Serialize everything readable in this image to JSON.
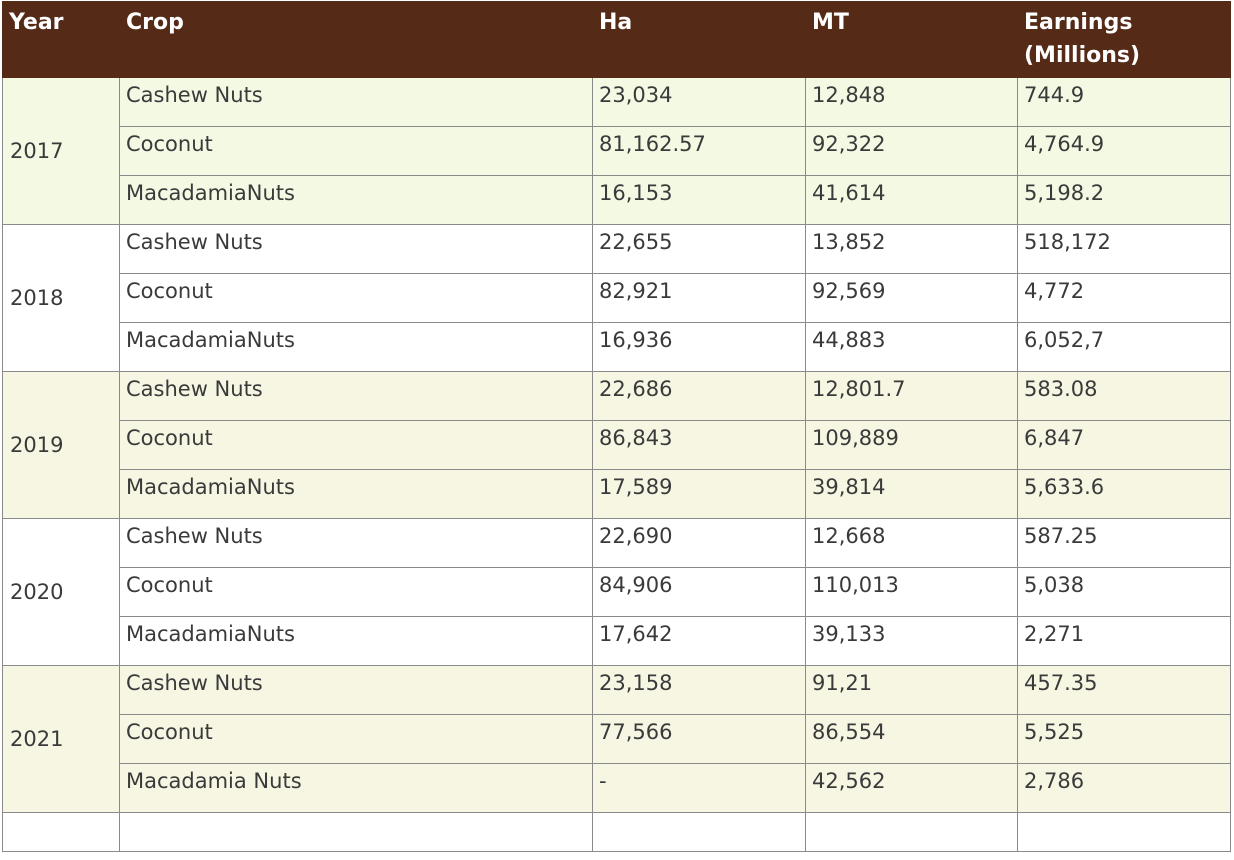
{
  "headers": {
    "year": "Year",
    "crop": "Crop",
    "ha": "Ha",
    "mt": "MT",
    "earnings_line1": "Earnings",
    "earnings_line2": "(Millions)"
  },
  "years": [
    {
      "year": "2017",
      "rows": [
        {
          "crop": "Cashew Nuts",
          "ha": "23,034",
          "mt": "12,848",
          "earnings": "744.9"
        },
        {
          "crop": "Coconut",
          "ha": "81,162.57",
          "mt": "92,322",
          "earnings": "4,764.9"
        },
        {
          "crop": "MacadamiaNuts",
          "ha": "16,153",
          "mt": "41,614",
          "earnings": "5,198.2"
        }
      ]
    },
    {
      "year": "2018",
      "rows": [
        {
          "crop": "Cashew Nuts",
          "ha": "22,655",
          "mt": "13,852",
          "earnings": "518,172"
        },
        {
          "crop": "Coconut",
          "ha": "82,921",
          "mt": "92,569",
          "earnings": "4,772"
        },
        {
          "crop": "MacadamiaNuts",
          "ha": "16,936",
          "mt": "44,883",
          "earnings": "6,052,7"
        }
      ]
    },
    {
      "year": "2019",
      "rows": [
        {
          "crop": "Cashew Nuts",
          "ha": "22,686",
          "mt": "12,801.7",
          "earnings": "583.08"
        },
        {
          "crop": "Coconut",
          "ha": "86,843",
          "mt": "109,889",
          "earnings": "6,847"
        },
        {
          "crop": "MacadamiaNuts",
          "ha": "17,589",
          "mt": "39,814",
          "earnings": "5,633.6"
        }
      ]
    },
    {
      "year": "2020",
      "rows": [
        {
          "crop": "Cashew Nuts",
          "ha": "22,690",
          "mt": "12,668",
          "earnings": "587.25"
        },
        {
          "crop": "Coconut",
          "ha": "84,906",
          "mt": "110,013",
          "earnings": "5,038"
        },
        {
          "crop": "MacadamiaNuts",
          "ha": "17,642",
          "mt": "39,133",
          "earnings": "2,271"
        }
      ]
    },
    {
      "year": "2021",
      "rows": [
        {
          "crop": "Cashew Nuts",
          "ha": "23,158",
          "mt": "91,21",
          "earnings": "457.35"
        },
        {
          "crop": "Coconut",
          "ha": "77,566",
          "mt": "86,554",
          "earnings": "5,525"
        },
        {
          "crop": "Macadamia Nuts",
          "ha": "-",
          "mt": "42,562",
          "earnings": "2,786"
        }
      ]
    }
  ],
  "colors": {
    "header_background": "#552a17",
    "header_text": "#ffffff",
    "band_2017": "#f3f9e3",
    "band_2019_2021": "#f6f6e3",
    "body_text": "#3a3a3a",
    "grid_line": "#8a8a8a"
  }
}
